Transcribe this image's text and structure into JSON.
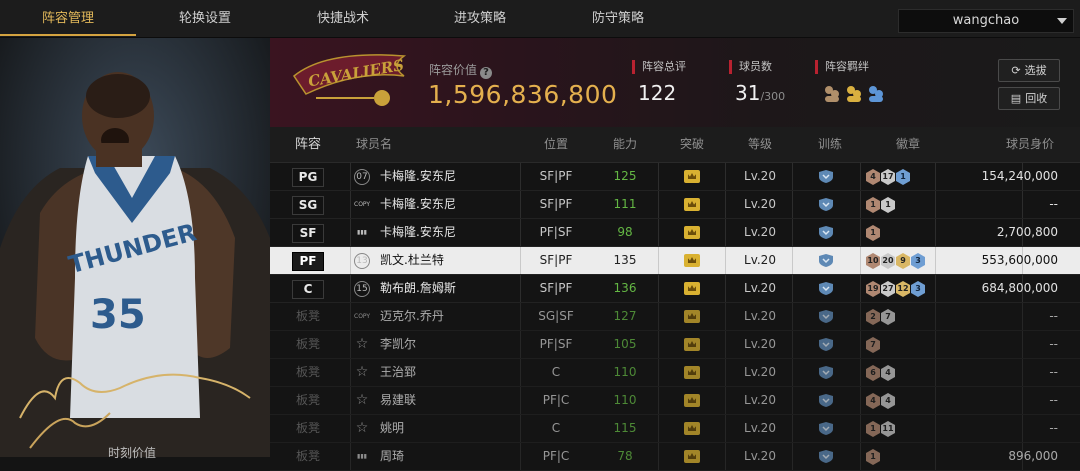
{
  "nav": {
    "tabs": [
      "阵容管理",
      "轮换设置",
      "快捷战术",
      "进攻策略",
      "防守策略"
    ],
    "active_tab": "阵容管理",
    "user": "wangchao"
  },
  "player_panel": {
    "jersey_team": "THUNDER",
    "jersey_number": "35",
    "bottom_label": "时刻价值"
  },
  "team": {
    "logo_text": "CAVALIERS",
    "value_label": "阵容价值",
    "value": "1,596,836,800",
    "stats": {
      "overall_label": "阵容总评",
      "overall": "122",
      "players_label": "球员数",
      "players": "31",
      "players_max": "/300",
      "bond_label": "阵容羁绊"
    },
    "buttons": {
      "pick": "选拔",
      "recycle": "回收"
    }
  },
  "table": {
    "headers": [
      "阵容",
      "球员名",
      "位置",
      "能力",
      "突破",
      "等级",
      "训练",
      "徽章",
      "球员身价"
    ],
    "rows": [
      {
        "slot": "PG",
        "icon": "07",
        "name": "卡梅隆.安东尼",
        "pos": "SF|PF",
        "ability": "125",
        "level": "Lv.20",
        "badges": [
          [
            "4",
            "bronze"
          ],
          [
            "17",
            "silver"
          ],
          [
            "1",
            "blue"
          ]
        ],
        "worth": "154,240,000"
      },
      {
        "slot": "SG",
        "icon": "COPY",
        "name": "卡梅隆.安东尼",
        "pos": "SF|PF",
        "ability": "111",
        "level": "Lv.20",
        "badges": [
          [
            "1",
            "bronze"
          ],
          [
            "1",
            "silver"
          ]
        ],
        "worth": "--"
      },
      {
        "slot": "SF",
        "icon": "bars",
        "name": "卡梅隆.安东尼",
        "pos": "PF|SF",
        "ability": "98",
        "level": "Lv.20",
        "badges": [
          [
            "1",
            "bronze"
          ]
        ],
        "worth": "2,700,800"
      },
      {
        "slot": "PF",
        "icon": "13",
        "name": "凯文.杜兰特",
        "pos": "SF|PF",
        "ability": "135",
        "level": "Lv.20",
        "badges": [
          [
            "10",
            "bronze"
          ],
          [
            "20",
            "silver"
          ],
          [
            "9",
            "gold"
          ],
          [
            "3",
            "blue"
          ]
        ],
        "worth": "553,600,000",
        "selected": true
      },
      {
        "slot": "C",
        "icon": "15",
        "name": "勒布朗.詹姆斯",
        "pos": "SF|PF",
        "ability": "136",
        "level": "Lv.20",
        "badges": [
          [
            "19",
            "bronze"
          ],
          [
            "27",
            "silver"
          ],
          [
            "12",
            "gold"
          ],
          [
            "3",
            "blue"
          ]
        ],
        "worth": "684,800,000"
      },
      {
        "slot": "板凳",
        "icon": "COPY",
        "name": "迈克尔.乔丹",
        "pos": "SG|SF",
        "ability": "127",
        "level": "Lv.20",
        "badges": [
          [
            "2",
            "bronze"
          ],
          [
            "7",
            "silver"
          ]
        ],
        "worth": "--"
      },
      {
        "slot": "板凳",
        "icon": "star",
        "name": "李凯尔",
        "pos": "PF|SF",
        "ability": "105",
        "level": "Lv.20",
        "badges": [
          [
            "7",
            "bronze"
          ]
        ],
        "worth": "--"
      },
      {
        "slot": "板凳",
        "icon": "star",
        "name": "王治郅",
        "pos": "C",
        "ability": "110",
        "level": "Lv.20",
        "badges": [
          [
            "6",
            "bronze"
          ],
          [
            "4",
            "silver"
          ]
        ],
        "worth": "--"
      },
      {
        "slot": "板凳",
        "icon": "star",
        "name": "易建联",
        "pos": "PF|C",
        "ability": "110",
        "level": "Lv.20",
        "badges": [
          [
            "4",
            "bronze"
          ],
          [
            "4",
            "silver"
          ]
        ],
        "worth": "--"
      },
      {
        "slot": "板凳",
        "icon": "star",
        "name": "姚明",
        "pos": "C",
        "ability": "115",
        "level": "Lv.20",
        "badges": [
          [
            "1",
            "bronze"
          ],
          [
            "11",
            "silver"
          ]
        ],
        "worth": "--"
      },
      {
        "slot": "板凳",
        "icon": "bars",
        "name": "周琦",
        "pos": "PF|C",
        "ability": "78",
        "level": "Lv.20",
        "badges": [
          [
            "1",
            "bronze"
          ]
        ],
        "worth": "896,000"
      }
    ]
  }
}
